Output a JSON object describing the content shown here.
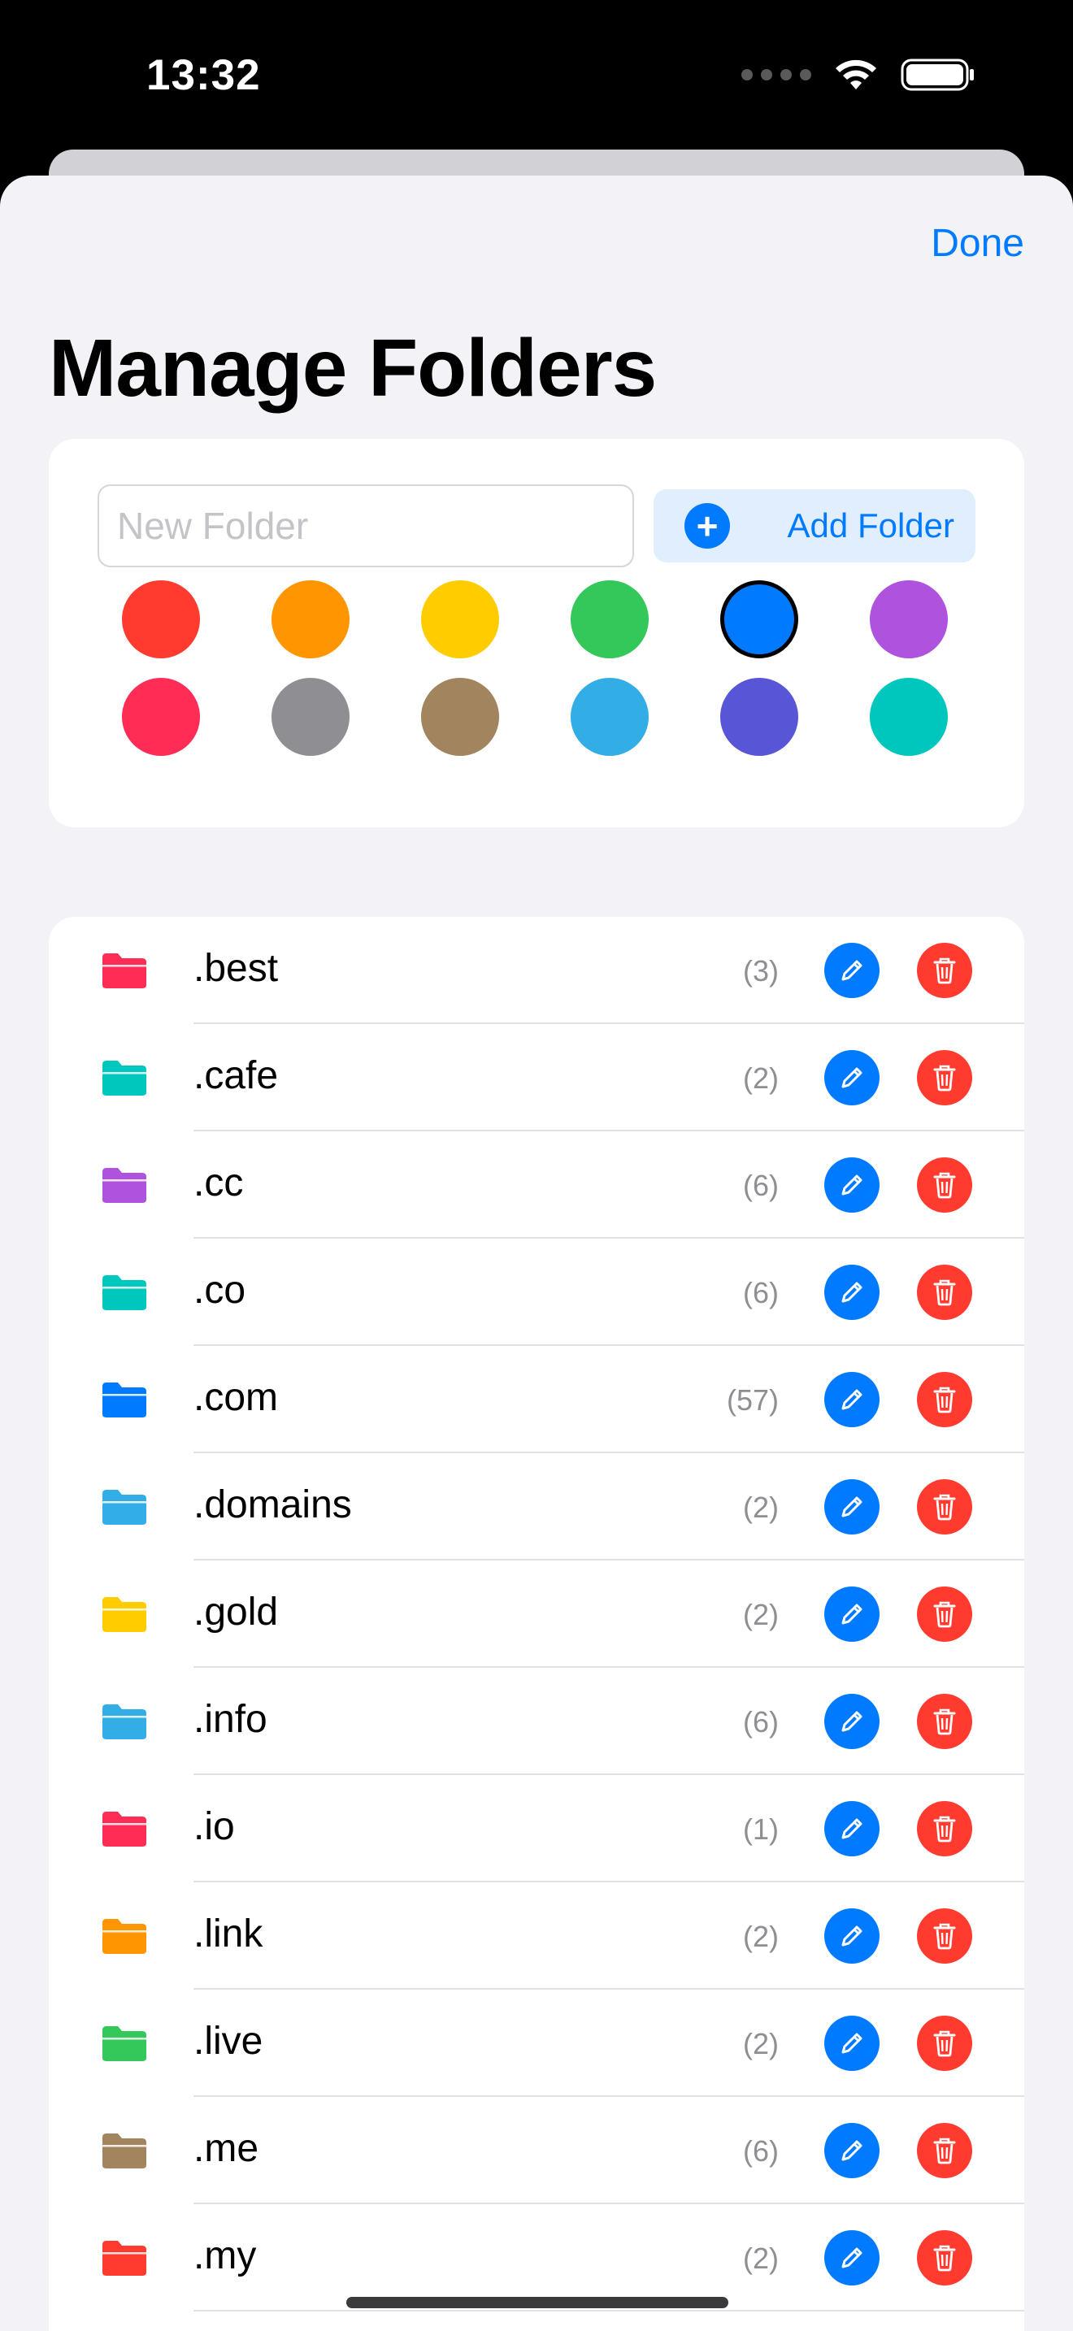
{
  "status_bar": {
    "time": "13:32"
  },
  "sheet": {
    "done_label": "Done",
    "title": "Manage Folders"
  },
  "create": {
    "input_placeholder": "New Folder",
    "input_value": "",
    "add_label": "Add Folder",
    "add_icon": "plus-circle-icon",
    "colors": [
      {
        "name": "red",
        "hex": "#ff3b30"
      },
      {
        "name": "orange",
        "hex": "#ff9500"
      },
      {
        "name": "yellow",
        "hex": "#ffcc00"
      },
      {
        "name": "green",
        "hex": "#34c759"
      },
      {
        "name": "blue",
        "hex": "#007aff"
      },
      {
        "name": "purple",
        "hex": "#af52de"
      },
      {
        "name": "pink",
        "hex": "#ff2d55"
      },
      {
        "name": "gray",
        "hex": "#8e8e93"
      },
      {
        "name": "brown",
        "hex": "#a2845e"
      },
      {
        "name": "cyan",
        "hex": "#32ade6"
      },
      {
        "name": "indigo",
        "hex": "#5856d6"
      },
      {
        "name": "mint",
        "hex": "#00c7be"
      }
    ],
    "selected_color": "blue"
  },
  "folders": [
    {
      "name": ".best",
      "count": "(3)",
      "color": "#ff2d55"
    },
    {
      "name": ".cafe",
      "count": "(2)",
      "color": "#00c7be"
    },
    {
      "name": ".cc",
      "count": "(6)",
      "color": "#af52de"
    },
    {
      "name": ".co",
      "count": "(6)",
      "color": "#00c7be"
    },
    {
      "name": ".com",
      "count": "(57)",
      "color": "#007aff"
    },
    {
      "name": ".domains",
      "count": "(2)",
      "color": "#32ade6"
    },
    {
      "name": ".gold",
      "count": "(2)",
      "color": "#ffcc00"
    },
    {
      "name": ".info",
      "count": "(6)",
      "color": "#32ade6"
    },
    {
      "name": ".io",
      "count": "(1)",
      "color": "#ff2d55"
    },
    {
      "name": ".link",
      "count": "(2)",
      "color": "#ff9500"
    },
    {
      "name": ".live",
      "count": "(2)",
      "color": "#34c759"
    },
    {
      "name": ".me",
      "count": "(6)",
      "color": "#a2845e"
    },
    {
      "name": ".my",
      "count": "(2)",
      "color": "#ff3b30"
    }
  ],
  "row_icons": {
    "folder": "folder-icon",
    "edit": "pencil-icon",
    "delete": "trash-icon"
  }
}
